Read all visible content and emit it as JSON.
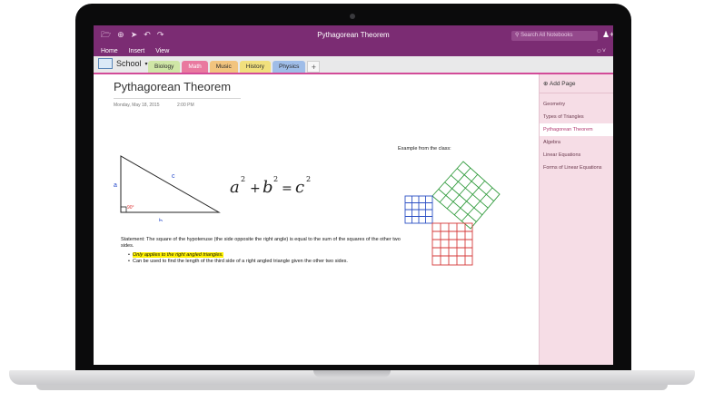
{
  "window": {
    "title": "Pythagorean Theorem",
    "search_placeholder": "Search All Notebooks"
  },
  "toolbar_icons": [
    "folder-icon",
    "add-icon",
    "forward-icon",
    "undo-icon",
    "redo-icon"
  ],
  "menu": {
    "items": [
      "Home",
      "Insert",
      "View"
    ]
  },
  "notebook": {
    "name": "School"
  },
  "sections": [
    {
      "label": "Biology",
      "color": "#cfe6a6"
    },
    {
      "label": "Math",
      "color": "#e9799f"
    },
    {
      "label": "Music",
      "color": "#f2c47e"
    },
    {
      "label": "History",
      "color": "#f1e07d"
    },
    {
      "label": "Physics",
      "color": "#9fbde8"
    }
  ],
  "page": {
    "title": "Pythagorean Theorem",
    "date": "Monday, May 18, 2015",
    "time": "2:00 PM",
    "example_label": "Example from the class:",
    "statement": "Statement: The square of the hypotenuse (the side opposite the right angle) is equal to the sum of the squares of the other two sides.",
    "bullets": [
      "Only applies to the right angled triangles.",
      "Can be used to find the length of the third side of a right angled triangle given the other two sides."
    ],
    "triangle_labels": {
      "a": "a",
      "b": "b",
      "c": "c",
      "angle": "90°"
    },
    "formula": {
      "a": "a",
      "b": "b",
      "c": "c",
      "exp": "2"
    }
  },
  "sidebar": {
    "add_page": "Add Page",
    "pages": [
      "Geometry",
      "Types of Triangles",
      "Pythagorean Theorem",
      "Algebra",
      "Linear Equations",
      "Forms of Linear Equations"
    ]
  },
  "colors": {
    "accent": "#7b2c73",
    "selected_tab": "#d24b98",
    "sidebar_bg": "#f6dde6"
  }
}
